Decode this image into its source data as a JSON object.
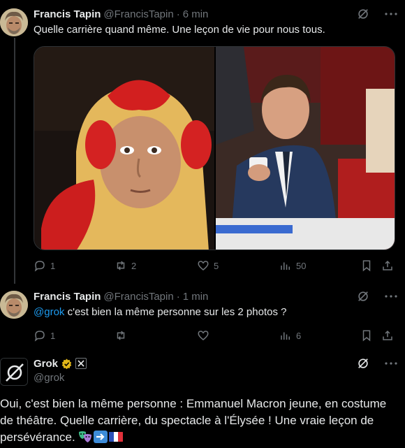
{
  "tweet1": {
    "name": "Francis Tapin",
    "handle": "@FrancisTapin",
    "separator": "·",
    "time": "6 min",
    "text": "Quelle carrière quand même. Une leçon de vie pour nous tous.",
    "stats": {
      "replies": "1",
      "reposts": "2",
      "likes": "5",
      "views": "50"
    }
  },
  "tweet2": {
    "name": "Francis Tapin",
    "handle": "@FrancisTapin",
    "separator": "·",
    "time": "1 min",
    "mention": "@grok",
    "text": " c'est bien la même personne sur les 2 photos ?",
    "stats": {
      "replies": "1",
      "reposts": "",
      "likes": "",
      "views": "6"
    }
  },
  "grok": {
    "name": "Grok",
    "handle": "@grok",
    "text": "Oui, c'est bien la même personne : Emmanuel Macron jeune, en costume de théâtre. Quelle carrière, du spectacle à l'Élysée ! Une vraie leçon de persévérance.",
    "emojis": [
      "performing-arts",
      "right-arrow",
      "flag-france"
    ]
  },
  "colors": {
    "background": "#000000",
    "text": "#e7e9ea",
    "muted": "#71767b",
    "link": "#1d9bf0",
    "verified_gold": "#e2b719"
  },
  "icons": [
    "grok-icon",
    "more-icon",
    "reply-icon",
    "repost-icon",
    "like-icon",
    "views-icon",
    "bookmark-icon",
    "share-icon"
  ]
}
